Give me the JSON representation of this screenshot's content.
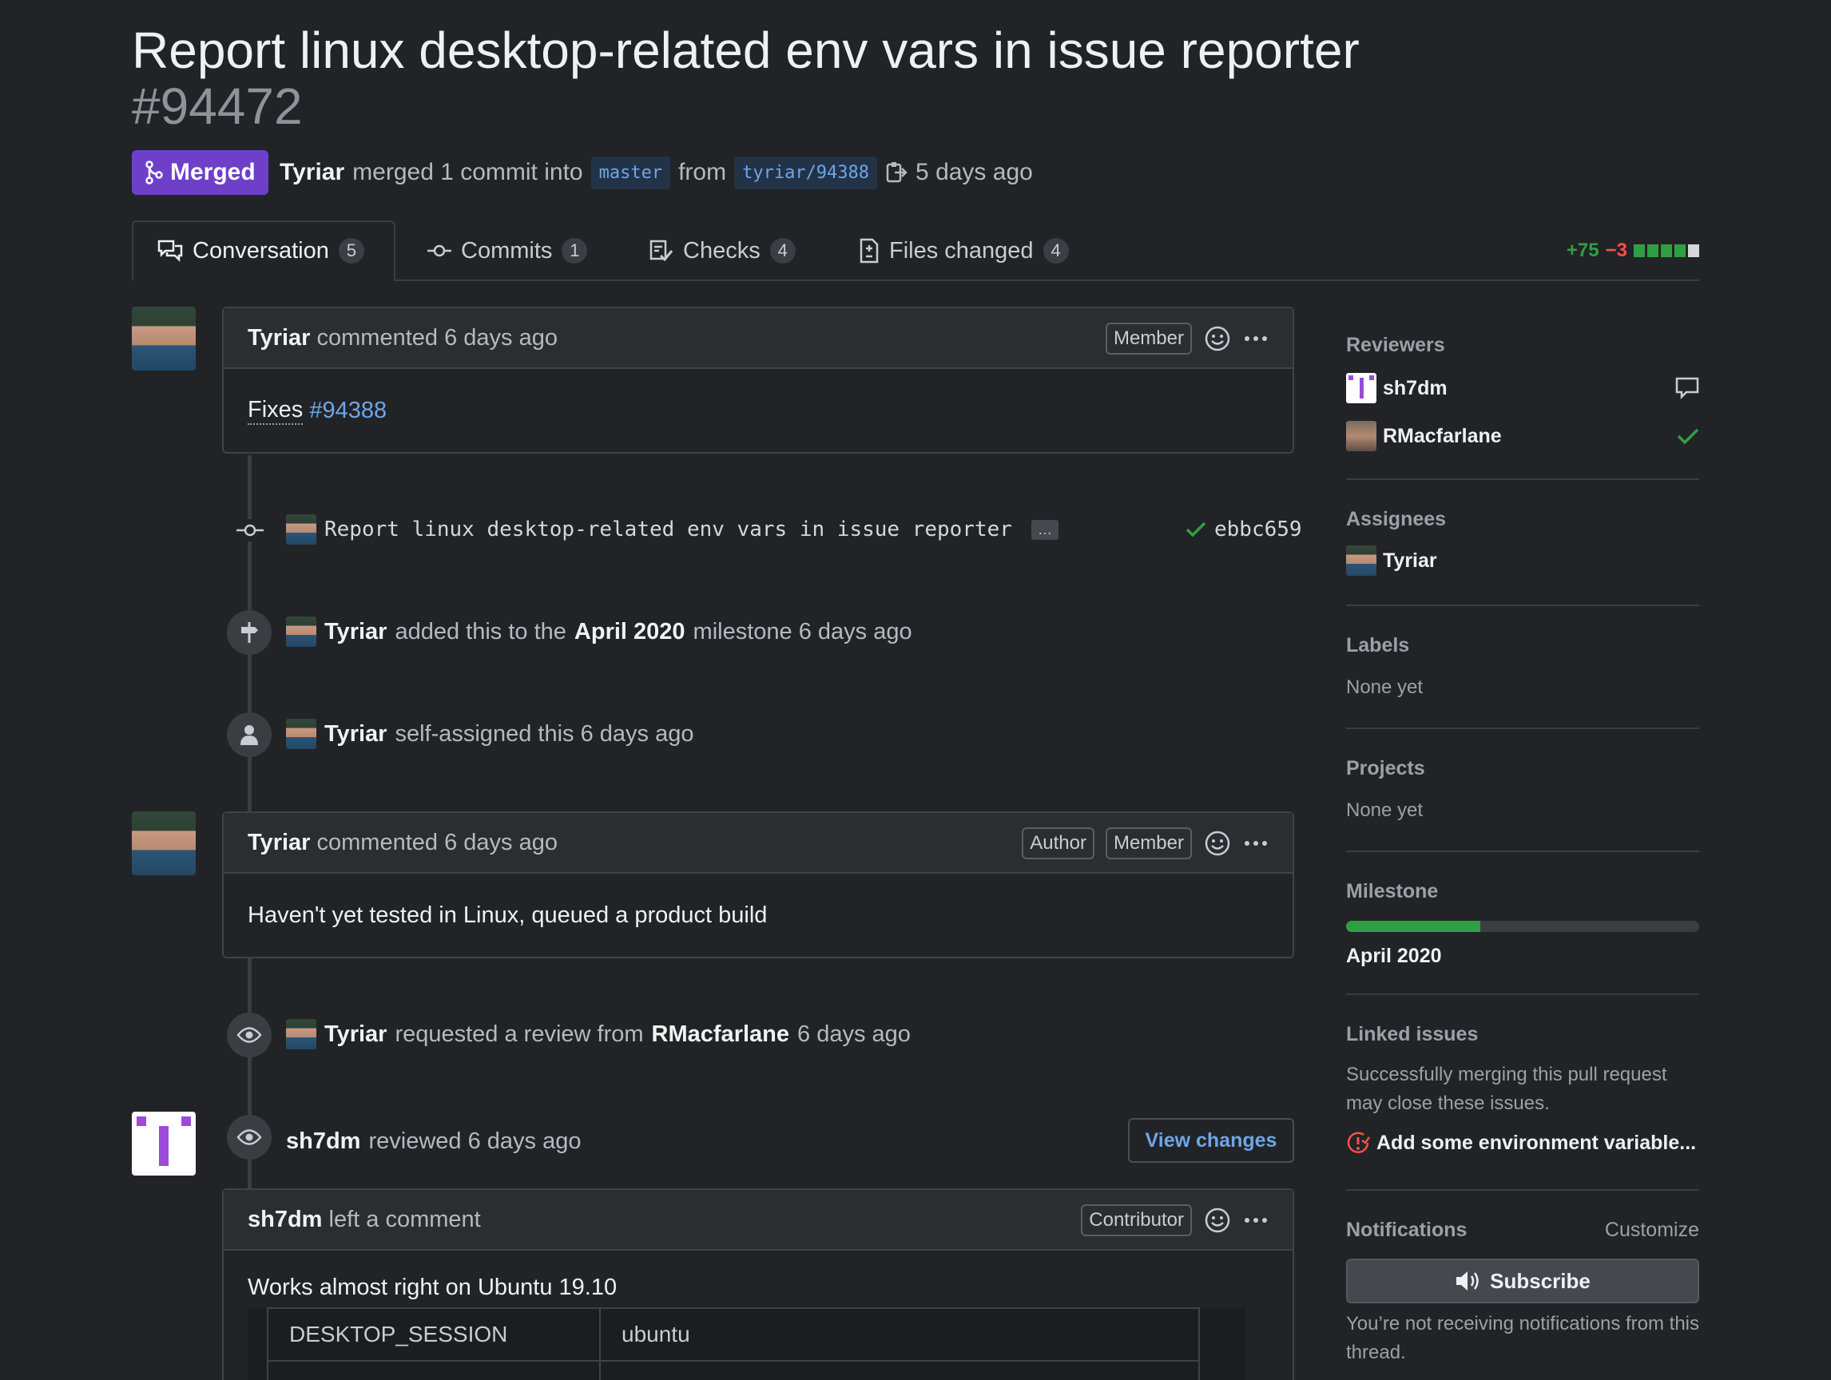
{
  "pr": {
    "title": "Report linux desktop-related env vars in issue reporter",
    "number": "#94472",
    "state": "Merged",
    "author": "Tyriar",
    "merged_text": "merged 1 commit into",
    "base_branch": "master",
    "from_text": "from",
    "head_branch": "tyriar/94388",
    "time": "5 days ago"
  },
  "tabs": [
    {
      "label": "Conversation",
      "count": "5"
    },
    {
      "label": "Commits",
      "count": "1"
    },
    {
      "label": "Checks",
      "count": "4"
    },
    {
      "label": "Files changed",
      "count": "4"
    }
  ],
  "diffstat": {
    "additions": "+75",
    "deletions": "−3",
    "colors": [
      "#2ea043",
      "#2ea043",
      "#2ea043",
      "#2ea043",
      "#d4d7db"
    ]
  },
  "timeline": {
    "comment1": {
      "author": "Tyriar",
      "action": "commented 6 days ago",
      "badge": "Member",
      "body_prefix": "Fixes",
      "body_link": "#94388"
    },
    "commit": {
      "message": "Report linux desktop-related env vars in issue reporter",
      "ellipsis": "…",
      "sha": "ebbc659"
    },
    "milestone_event": {
      "actor": "Tyriar",
      "text1": "added this to the",
      "milestone": "April 2020",
      "text2": "milestone 6 days ago"
    },
    "assign_event": {
      "actor": "Tyriar",
      "text": "self-assigned this 6 days ago"
    },
    "comment2": {
      "author": "Tyriar",
      "action": "commented 6 days ago",
      "badge1": "Author",
      "badge2": "Member",
      "body": "Haven't yet tested in Linux, queued a product build"
    },
    "review_request": {
      "actor": "Tyriar",
      "text1": "requested a review from",
      "reviewer": "RMacfarlane",
      "text2": "6 days ago"
    },
    "review": {
      "actor": "sh7dm",
      "text": "reviewed 6 days ago",
      "button": "View changes"
    },
    "review_comment": {
      "author": "sh7dm",
      "action": "left a comment",
      "badge": "Contributor",
      "body": "Works almost right on Ubuntu 19.10",
      "table": [
        [
          "DESKTOP_SESSION",
          "ubuntu"
        ]
      ]
    }
  },
  "sidebar": {
    "reviewers_title": "Reviewers",
    "reviewers": [
      {
        "name": "sh7dm",
        "status": "commented"
      },
      {
        "name": "RMacfarlane",
        "status": "approved"
      }
    ],
    "assignees_title": "Assignees",
    "assignees": [
      "Tyriar"
    ],
    "labels_title": "Labels",
    "labels_value": "None yet",
    "projects_title": "Projects",
    "projects_value": "None yet",
    "milestone_title": "Milestone",
    "milestone_name": "April 2020",
    "milestone_progress": 0.38,
    "linked_title": "Linked issues",
    "linked_desc": "Successfully merging this pull request may close these issues.",
    "linked_issue": "Add some environment variable...",
    "notifications_title": "Notifications",
    "customize": "Customize",
    "subscribe": "Subscribe",
    "notif_desc": "You’re not receiving notifications from this thread."
  },
  "colors": {
    "accent": "#6ea6e8",
    "merged": "#6e40c9",
    "success": "#2ea043",
    "danger": "#f85149"
  }
}
